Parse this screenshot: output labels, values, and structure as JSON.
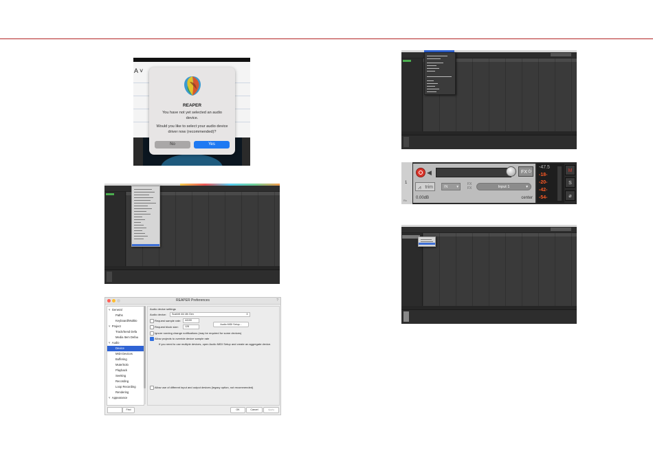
{
  "dialog": {
    "app_name": "REAPER",
    "message_1": "You have not yet selected an audio device.",
    "message_2": "Would you like to select your audio device driver now (recommended)?",
    "no_label": "No",
    "yes_label": "Yes",
    "bg_glyph": "A ˅"
  },
  "prefs": {
    "window_title": "REAPER Preferences",
    "tree": [
      {
        "label": "General",
        "level": 0,
        "expander": "˅"
      },
      {
        "label": "Paths",
        "level": 1
      },
      {
        "label": "Keyboard/Multito",
        "level": 1
      },
      {
        "label": "Project",
        "level": 0,
        "expander": "˅"
      },
      {
        "label": "Track/Send Defa",
        "level": 1
      },
      {
        "label": "Media Item Defau",
        "level": 1
      },
      {
        "label": "Audio",
        "level": 0,
        "expander": "˅"
      },
      {
        "label": "Device",
        "level": 1,
        "selected": true
      },
      {
        "label": "MIDI Devices",
        "level": 1
      },
      {
        "label": "Buffering",
        "level": 1
      },
      {
        "label": "Mute/Solo",
        "level": 1
      },
      {
        "label": "Playback",
        "level": 1
      },
      {
        "label": "Seeking",
        "level": 1
      },
      {
        "label": "Recording",
        "level": 1
      },
      {
        "label": "Loop Recording",
        "level": 1
      },
      {
        "label": "Rendering",
        "level": 1
      },
      {
        "label": "Appearance",
        "level": 0,
        "expander": "˅"
      }
    ],
    "section_title": "Audio device settings",
    "audio_device_label": "Audio device:",
    "audio_device_value": "Scarlett 4i4 4th Gen",
    "sample_rate_label": "Request sample rate:",
    "sample_rate_value": "44100",
    "block_size_label": "Request block size:",
    "block_size_value": "128",
    "midi_setup_label": "Audio MIDI Setup...",
    "ignore_label": "Ignore running change notifications (may be required for some devices)",
    "allow_label": "Allow projects to override device sample rate",
    "aggregate_note": "If you need to use multiple devices, open Audio MIDI Setup and create an aggregate device.",
    "legacy_label": "Allow use of different input and output devices (legacy option, not recommended)",
    "find_label": "Find",
    "ok_label": "OK",
    "cancel_label": "Cancel",
    "apply_label": "Apply",
    "close_glyph": "?"
  },
  "track": {
    "number": "1",
    "env_label": "Rx",
    "fx_label": "FX",
    "fx_power": "⏻",
    "trim_label": "trim",
    "in_label": "IN",
    "fx_in_label": "FX\nFX",
    "input_label": "Input 1",
    "volume": "0.00dB",
    "pan": "center",
    "meter_values": [
      "-47.5",
      "-18-",
      "-20-",
      "-42-",
      "-54-"
    ],
    "side_buttons": [
      "M",
      "S",
      "⌀"
    ]
  },
  "colors": {
    "rule_red": "#b22222",
    "reaper_select_blue": "#2f63d4",
    "yes_blue": "#1e79f2",
    "record_red": "#d9352b",
    "meter_orange": "#ff5a24"
  }
}
